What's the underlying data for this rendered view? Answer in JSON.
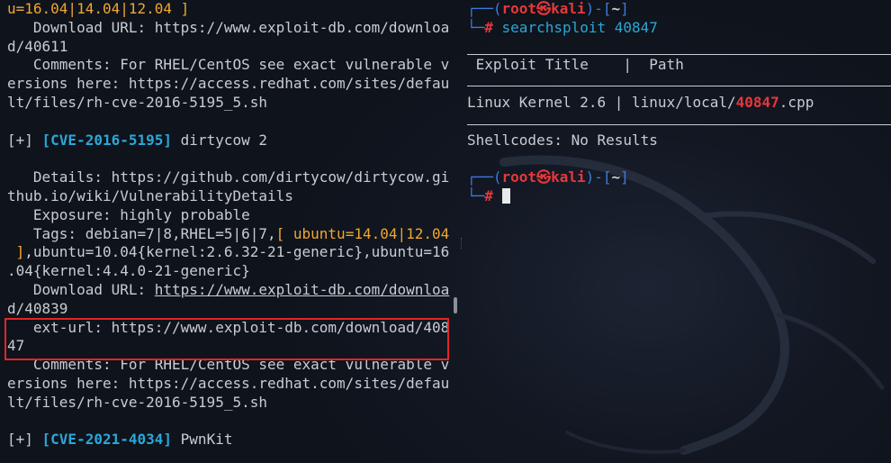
{
  "left_pane": {
    "l1": "u=16.04|14.04|12.04 ]",
    "l2": "   Download URL: https://www.exploit-db.com/downloa",
    "l3": "d/40611",
    "l4": "   Comments: For RHEL/CentOS see exact vulnerable v",
    "l5": "ersions here: https://access.redhat.com/sites/defau",
    "l6": "lt/files/rh-cve-2016-5195_5.sh",
    "e1_prefix": "[+] ",
    "e1_cve": "[CVE-2016-5195]",
    "e1_name": " dirtycow 2",
    "l9": "   Details: https://github.com/dirtycow/dirtycow.gi",
    "l10": "thub.io/wiki/VulnerabilityDetails",
    "l11": "   Exposure: highly probable",
    "l12a": "   Tags: debian=7|8,RHEL=5|6|7,",
    "l12b": "[ ubuntu=14.04|12.04",
    "l13a": " ]",
    "l13b": ",ubuntu=10.04{kernel:2.6.32-21-generic},ubuntu=16",
    "l14": ".04{kernel:4.4.0-21-generic}",
    "l15a": "   Download URL: ",
    "l15b": "https://www.exploit-db.com/downloa",
    "l16": "d/40839",
    "l17": "   ext-url: https://www.exploit-db.com/download/408",
    "l18": "47",
    "l19": "   Comments: For RHEL/CentOS see exact vulnerable v",
    "l20": "ersions here: https://access.redhat.com/sites/defau",
    "l21": "lt/files/rh-cve-2016-5195_5.sh",
    "e2_prefix": "[+] ",
    "e2_cve": "[CVE-2021-4034]",
    "e2_name": " PwnKit"
  },
  "right_pane": {
    "prompt_open": "┌──(",
    "user": "root",
    "at": "㉿",
    "host": "kali",
    "prompt_mid": ")-[",
    "cwd": "~",
    "prompt_close": "]",
    "prompt_line2": "└─",
    "hash": "#",
    "command": " searchsploit 40847",
    "table_header": " Exploit Title    |  Path",
    "row_title": "Linux Kernel 2.6",
    "row_sep": " | ",
    "row_path_pre": "linux/local/",
    "row_path_id": "40847",
    "row_path_ext": ".cpp",
    "shellcodes": "Shellcodes: No Results"
  },
  "colors": {
    "background": "#10141c",
    "text": "#c8ccd2",
    "orange": "#f0a732",
    "cyan": "#2aa7d8",
    "red": "#e5383b",
    "blue": "#3d7be0",
    "highlight_box": "#e0262a"
  }
}
